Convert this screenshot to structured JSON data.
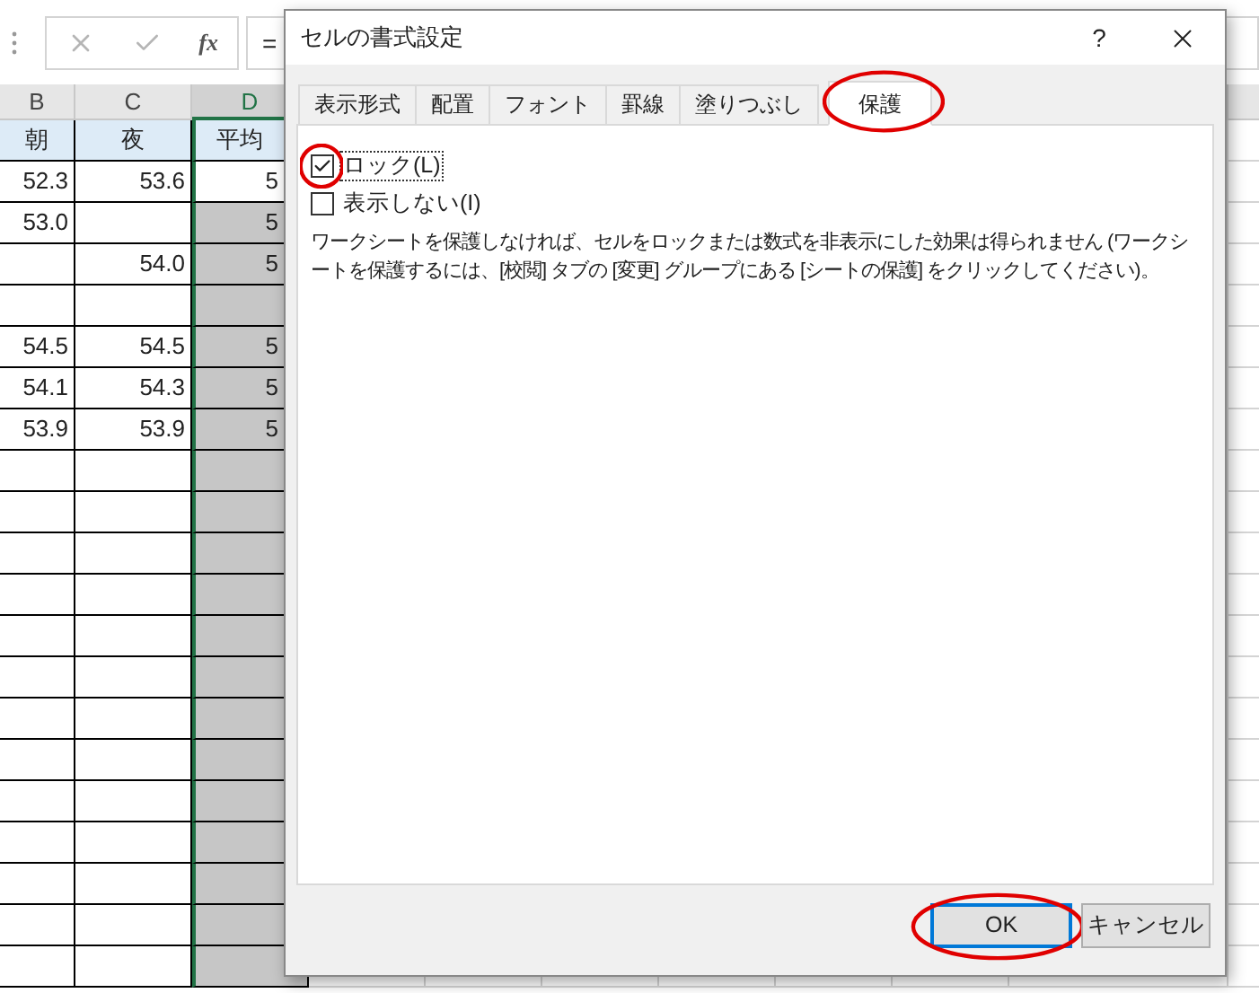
{
  "formula_bar": {
    "function_label": "fx",
    "formula": "="
  },
  "columns": [
    {
      "label": "B",
      "selected": false
    },
    {
      "label": "C",
      "selected": false
    },
    {
      "label": "D",
      "selected": true
    }
  ],
  "rows": [
    {
      "kind": "header",
      "cells": [
        "朝",
        "夜",
        "平均"
      ]
    },
    {
      "kind": "data",
      "active": true,
      "cells": [
        "52.3",
        "53.6",
        "5"
      ]
    },
    {
      "kind": "data",
      "active": false,
      "cells": [
        "53.0",
        "",
        "5"
      ]
    },
    {
      "kind": "data",
      "active": false,
      "cells": [
        "",
        "54.0",
        "5"
      ]
    },
    {
      "kind": "data",
      "active": false,
      "cells": [
        "",
        "",
        ""
      ]
    },
    {
      "kind": "data",
      "active": false,
      "cells": [
        "54.5",
        "54.5",
        "5"
      ]
    },
    {
      "kind": "data",
      "active": false,
      "cells": [
        "54.1",
        "54.3",
        "5"
      ]
    },
    {
      "kind": "data",
      "active": false,
      "cells": [
        "53.9",
        "53.9",
        "5"
      ]
    }
  ],
  "dialog": {
    "title": "セルの書式設定",
    "help": "?",
    "tabs": [
      {
        "label": "表示形式",
        "selected": false,
        "circled": false
      },
      {
        "label": "配置",
        "selected": false,
        "circled": false
      },
      {
        "label": "フォント",
        "selected": false,
        "circled": false
      },
      {
        "label": "罫線",
        "selected": false,
        "circled": false
      },
      {
        "label": "塗りつぶし",
        "selected": false,
        "circled": false
      },
      {
        "label": "保護",
        "selected": true,
        "circled": true
      }
    ],
    "checkboxes": [
      {
        "label": "ロック(L)",
        "checked": true,
        "focused": true,
        "circled": true
      },
      {
        "label": "表示しない(I)",
        "checked": false,
        "focused": false,
        "circled": false
      }
    ],
    "description": "ワークシートを保護しなければ、セルをロックまたは数式を非表示にした効果は得られません (ワークシートを保護するには、[校閲] タブの [変更] グループにある [シートの保護] をクリックしてください)。",
    "buttons": [
      {
        "label": "OK",
        "default": true,
        "circled": true
      },
      {
        "label": "キャンセル",
        "default": false,
        "circled": false
      }
    ]
  }
}
